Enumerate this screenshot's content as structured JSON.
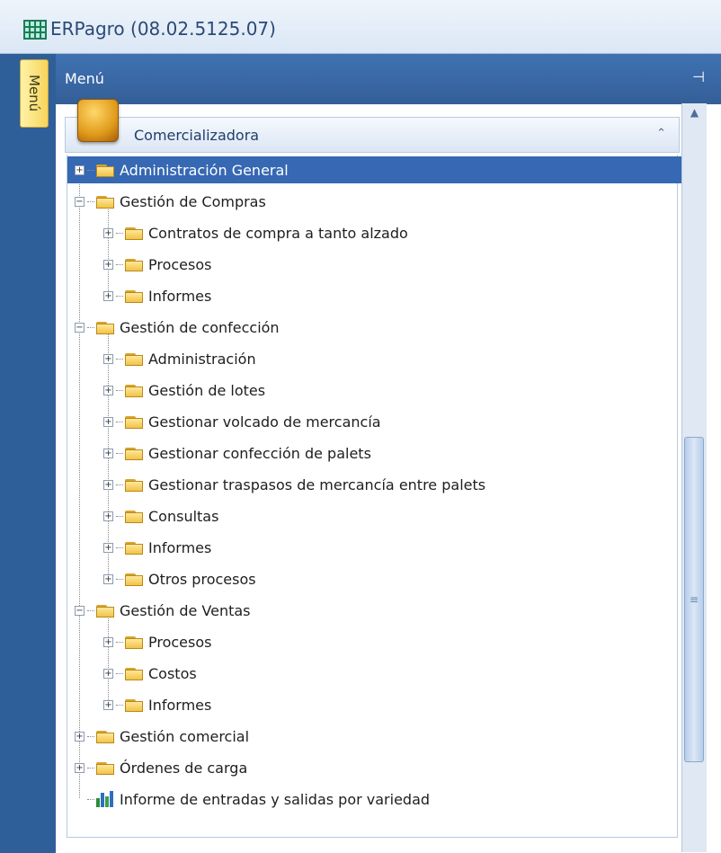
{
  "window": {
    "title": "ERPagro (08.02.5125.07)",
    "icon": "erp-grid-icon"
  },
  "side_tab": {
    "label": "Menú"
  },
  "panel": {
    "title": "Menú",
    "pin_icon": "pin-icon"
  },
  "group": {
    "label": "Comercializadora",
    "icon": "cube-icon",
    "collapse_icon": "double-chevron-up-icon"
  },
  "tree": {
    "items": [
      {
        "label": "Administración General",
        "level": 0,
        "state": "collapsed",
        "selected": true
      },
      {
        "label": "Gestión de Compras",
        "level": 0,
        "state": "expanded"
      },
      {
        "label": "Contratos de compra a tanto alzado",
        "level": 1,
        "state": "collapsed"
      },
      {
        "label": "Procesos",
        "level": 1,
        "state": "collapsed"
      },
      {
        "label": "Informes",
        "level": 1,
        "state": "collapsed"
      },
      {
        "label": "Gestión de confección",
        "level": 0,
        "state": "expanded"
      },
      {
        "label": "Administración",
        "level": 1,
        "state": "collapsed"
      },
      {
        "label": "Gestión de lotes",
        "level": 1,
        "state": "collapsed"
      },
      {
        "label": "Gestionar volcado de mercancía",
        "level": 1,
        "state": "collapsed"
      },
      {
        "label": "Gestionar confección de palets",
        "level": 1,
        "state": "collapsed"
      },
      {
        "label": "Gestionar traspasos de mercancía entre palets",
        "level": 1,
        "state": "collapsed"
      },
      {
        "label": "Consultas",
        "level": 1,
        "state": "collapsed"
      },
      {
        "label": "Informes",
        "level": 1,
        "state": "collapsed"
      },
      {
        "label": "Otros procesos",
        "level": 1,
        "state": "collapsed"
      },
      {
        "label": "Gestión de Ventas",
        "level": 0,
        "state": "expanded"
      },
      {
        "label": "Procesos",
        "level": 1,
        "state": "collapsed"
      },
      {
        "label": "Costos",
        "level": 1,
        "state": "collapsed"
      },
      {
        "label": "Informes",
        "level": 1,
        "state": "collapsed"
      },
      {
        "label": "Gestión comercial",
        "level": 0,
        "state": "collapsed"
      },
      {
        "label": "Órdenes de carga",
        "level": 0,
        "state": "collapsed"
      },
      {
        "label": "Informe de entradas y salidas por variedad",
        "level": 0,
        "state": "leaf",
        "icon": "bar-chart-icon"
      }
    ]
  },
  "colors": {
    "selection": "#3668b3",
    "panel_header": "#3f72b2",
    "side_tab": "#f7d45c"
  }
}
